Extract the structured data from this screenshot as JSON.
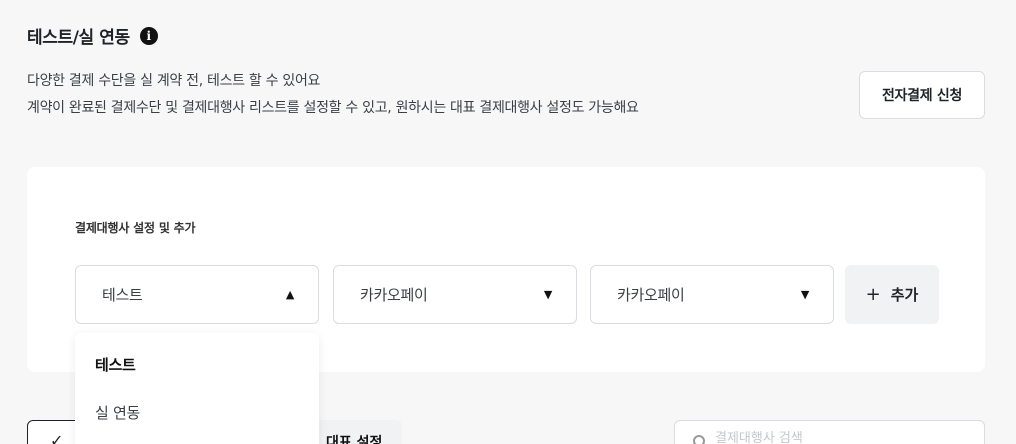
{
  "header": {
    "title": "테스트/실 연동",
    "info_icon": "info-icon",
    "description_line1": "다양한 결제 수단을 실 계약 전, 테스트 할 수 있어요",
    "description_line2": "계약이 완료된 결제수단 및 결제대행사 리스트를 설정할 수 있고, 원하시는 대표 결제대행사 설정도 가능해요",
    "apply_button": "전자결제 신청"
  },
  "pg_settings": {
    "label": "결제대행사 설정 및 추가",
    "selects": [
      {
        "value": "테스트",
        "caret": "▲",
        "open": true
      },
      {
        "value": "카카오페이",
        "caret": "▼",
        "open": false
      },
      {
        "value": "카카오페이",
        "caret": "▼",
        "open": false
      }
    ],
    "add_button": {
      "icon": "+",
      "label": "추가"
    },
    "dropdown_options": [
      "테스트",
      "실 연동"
    ],
    "dropdown_selected": "테스트"
  },
  "bottom": {
    "check_icon": "✓",
    "chip_label": "대표 설정",
    "search_placeholder": "결제대행사 검색"
  }
}
